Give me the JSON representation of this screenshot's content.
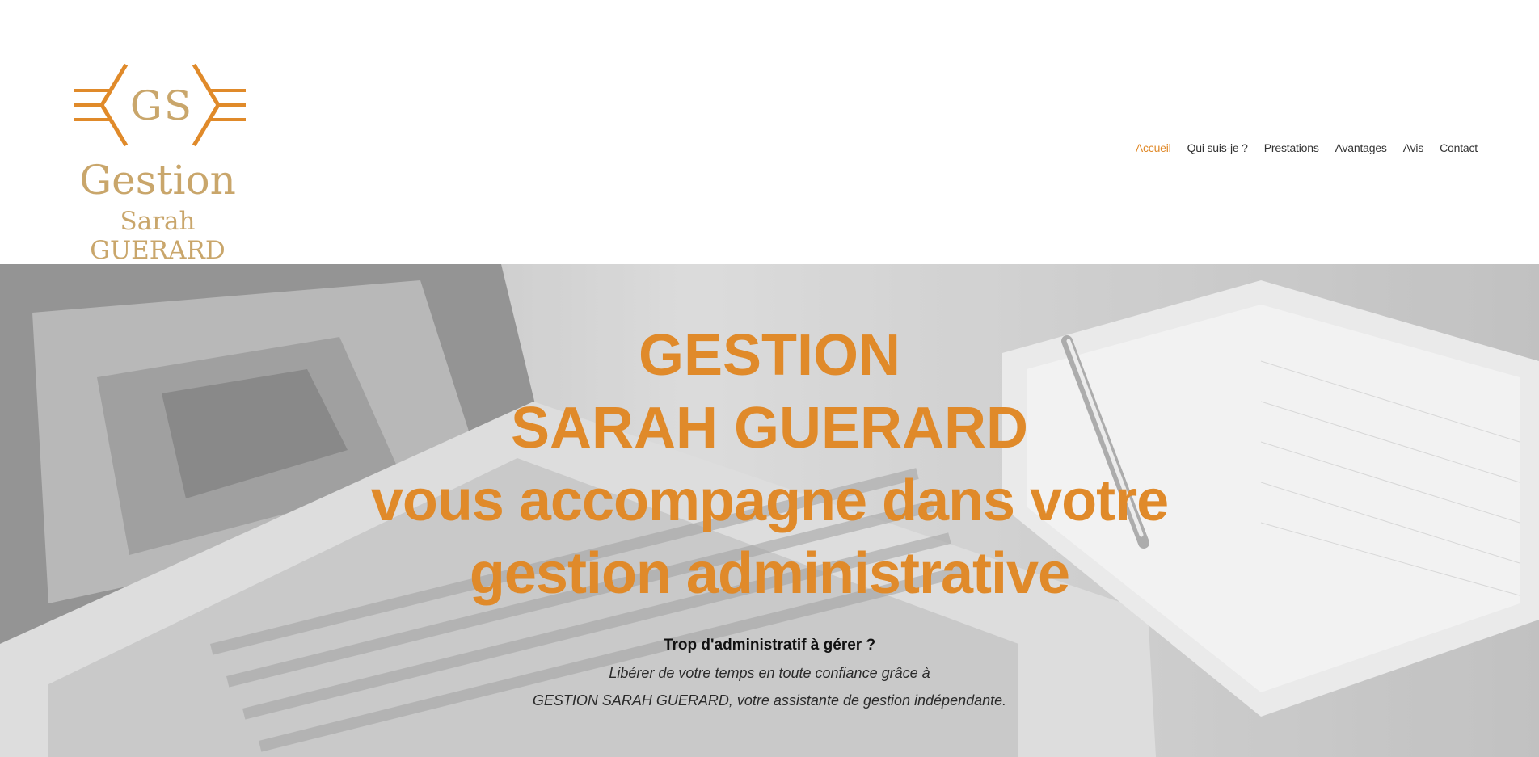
{
  "logo": {
    "monogram": "GS",
    "word": "Gestion",
    "name": "Sarah GUERARD",
    "color": "#c9a66b",
    "accent": "#e08a2a"
  },
  "nav": {
    "items": [
      {
        "label": "Accueil",
        "active": true
      },
      {
        "label": "Qui suis-je ?"
      },
      {
        "label": "Prestations"
      },
      {
        "label": "Avantages"
      },
      {
        "label": "Avis"
      },
      {
        "label": "Contact"
      }
    ]
  },
  "hero": {
    "title_line1": "GESTION",
    "title_line2": "SARAH GUERARD",
    "title_line3": "vous accompagne dans votre",
    "title_line4": "gestion administrative",
    "question": "Trop d'administratif à gérer ?",
    "line1": "Libérer de votre temps en toute confiance grâce à",
    "line2": "GESTION SARAH GUERARD, votre assistante de gestion indépendante.",
    "title_color": "#e08a2a",
    "background_image": "laptop-and-notebook-photo"
  }
}
